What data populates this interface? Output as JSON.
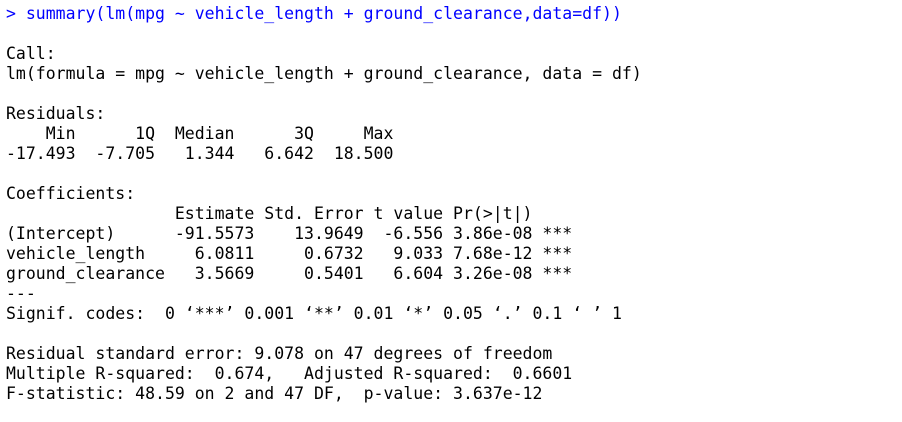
{
  "console": {
    "prompt": "> ",
    "command": "summary(lm(mpg ~ vehicle_length + ground_clearance,data=df))",
    "call_header": "Call:",
    "call": "lm(formula = mpg ~ vehicle_length + ground_clearance, data = df)",
    "residuals_header": "Residuals:",
    "residuals_labels": "    Min      1Q  Median      3Q     Max ",
    "residuals_values": "-17.493  -7.705   1.344   6.642  18.500 ",
    "coefficients_header": "Coefficients:",
    "coef_columns": "                 Estimate Std. Error t value Pr(>|t|)    ",
    "coef_rows": [
      "(Intercept)      -91.5573    13.9649  -6.556 3.86e-08 ***",
      "vehicle_length     6.0811     0.6732   9.033 7.68e-12 ***",
      "ground_clearance   3.5669     0.5401   6.604 3.26e-08 ***"
    ],
    "separator": "---",
    "signif_codes": "Signif. codes:  0 ‘***’ 0.001 ‘**’ 0.01 ‘*’ 0.05 ‘.’ 0.1 ‘ ’ 1",
    "residual_se": "Residual standard error: 9.078 on 47 degrees of freedom",
    "r_squared": "Multiple R-squared:  0.674,\tAdjusted R-squared:  0.6601 ",
    "f_statistic": "F-statistic: 48.59 on 2 and 47 DF,  p-value: 3.637e-12"
  },
  "colors": {
    "command": "#0000ff",
    "output": "#000000",
    "background": "#ffffff"
  }
}
